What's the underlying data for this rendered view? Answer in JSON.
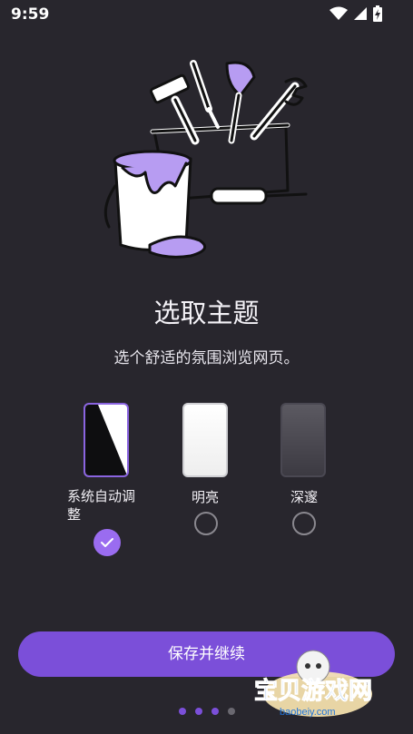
{
  "status_bar": {
    "time": "9:59"
  },
  "onboarding": {
    "title": "选取主题",
    "subtitle": "选个舒适的氛围浏览网页。",
    "themes": [
      {
        "label": "系统自动调整",
        "selected": true
      },
      {
        "label": "明亮",
        "selected": false
      },
      {
        "label": "深邃",
        "selected": false
      }
    ],
    "save_button": "保存并继续"
  },
  "pager": {
    "total": 4,
    "active_index": 3
  },
  "colors": {
    "background": "#28262d",
    "accent": "#7b4fd9",
    "check": "#9a6cf0"
  },
  "watermark": {
    "title": "宝贝游戏网",
    "url": "baobeiy.com"
  }
}
